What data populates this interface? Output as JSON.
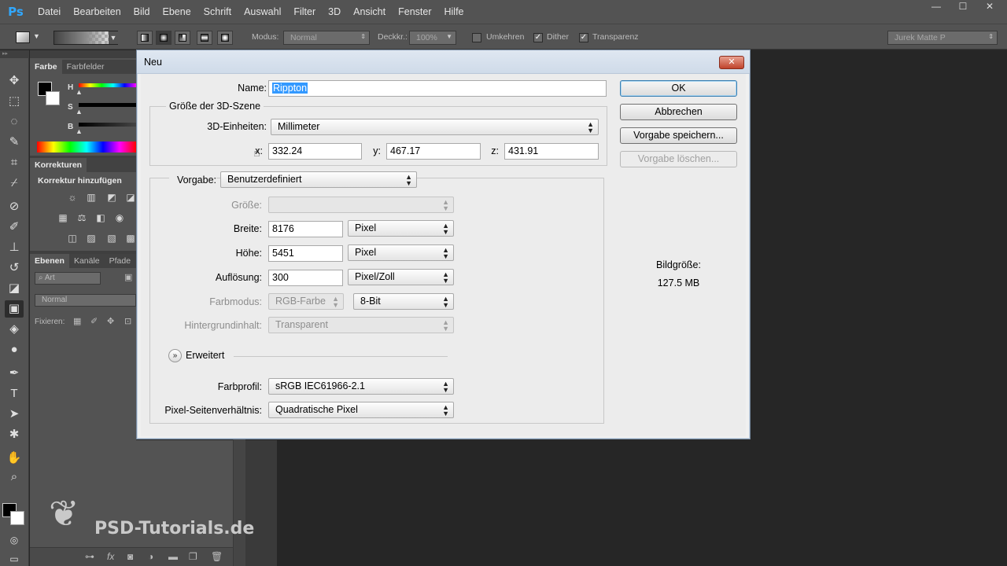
{
  "app": {
    "logo": "Ps",
    "menu": [
      "Datei",
      "Bearbeiten",
      "Bild",
      "Ebene",
      "Schrift",
      "Auswahl",
      "Filter",
      "3D",
      "Ansicht",
      "Fenster",
      "Hilfe"
    ],
    "window_controls": [
      "—",
      "☐",
      "✕"
    ]
  },
  "options_bar": {
    "mode_label": "Modus:",
    "mode_value": "Normal",
    "opacity_label": "Deckkr.:",
    "opacity_value": "100%",
    "reverse_label": "Umkehren",
    "reverse_checked": false,
    "dither_label": "Dither",
    "dither_checked": true,
    "transparency_label": "Transparenz",
    "transparency_checked": true,
    "workspace": "Jurek Matte P"
  },
  "panels": {
    "color_tabs": [
      "Farbe",
      "Farbfelder"
    ],
    "sliders": [
      "H",
      "S",
      "B"
    ],
    "adjustments_tab": "Korrekturen",
    "adjustments_title": "Korrektur hinzufügen",
    "layers_tabs": [
      "Ebenen",
      "Kanäle",
      "Pfade"
    ],
    "layers_filter": "Art",
    "blend_mode": "Normal",
    "lock_label": "Fixieren:"
  },
  "watermark": {
    "text": "PSD-Tutorials.de"
  },
  "dialog": {
    "title": "Neu",
    "close": "✕",
    "name_label": "Name:",
    "name_value": "Rippton",
    "group_3d_title": "Größe der 3D-Szene",
    "units_label": "3D-Einheiten:",
    "units_value": "Millimeter",
    "x_label": "x:",
    "x_value": "332.24",
    "y_label": "y:",
    "y_value": "467.17",
    "z_label": "z:",
    "z_value": "431.91",
    "preset_label": "Vorgabe:",
    "preset_value": "Benutzerdefiniert",
    "size_label": "Größe:",
    "size_value": "",
    "width_label": "Breite:",
    "width_value": "8176",
    "width_unit": "Pixel",
    "height_label": "Höhe:",
    "height_value": "5451",
    "height_unit": "Pixel",
    "resolution_label": "Auflösung:",
    "resolution_value": "300",
    "resolution_unit": "Pixel/Zoll",
    "colormode_label": "Farbmodus:",
    "colormode_value": "RGB-Farbe",
    "bitdepth_value": "8-Bit",
    "background_label": "Hintergrundinhalt:",
    "background_value": "Transparent",
    "advanced_label": "Erweitert",
    "profile_label": "Farbprofil:",
    "profile_value": "sRGB IEC61966-2.1",
    "aspect_label": "Pixel-Seitenverhältnis:",
    "aspect_value": "Quadratische Pixel",
    "buttons": {
      "ok": "OK",
      "cancel": "Abbrechen",
      "save_preset": "Vorgabe speichern...",
      "delete_preset": "Vorgabe löschen..."
    },
    "image_size_label": "Bildgröße:",
    "image_size_value": "127.5 MB"
  }
}
